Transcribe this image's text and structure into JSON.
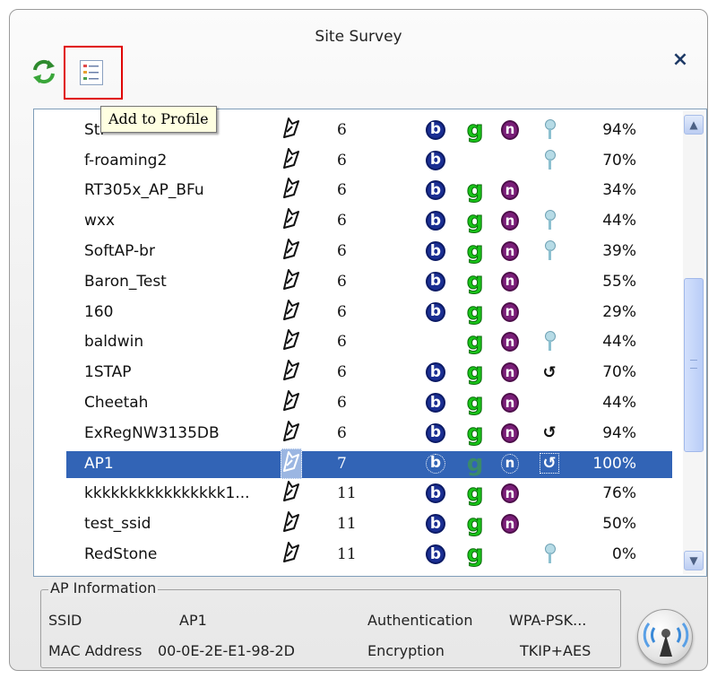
{
  "window": {
    "title": "Site Survey",
    "close_label": "×"
  },
  "toolbar": {
    "tooltip": "Add to Profile"
  },
  "list": {
    "rows": [
      {
        "ssid": "Sti",
        "channel": "6",
        "b": true,
        "g": true,
        "n": true,
        "security": "key",
        "signal": "94%"
      },
      {
        "ssid": "f-roaming2",
        "channel": "6",
        "b": true,
        "g": false,
        "n": false,
        "security": "key",
        "signal": "70%"
      },
      {
        "ssid": "RT305x_AP_BFu",
        "channel": "6",
        "b": true,
        "g": true,
        "n": true,
        "security": "",
        "signal": "34%"
      },
      {
        "ssid": "wxx",
        "channel": "6",
        "b": true,
        "g": true,
        "n": true,
        "security": "key",
        "signal": "44%"
      },
      {
        "ssid": "SoftAP-br",
        "channel": "6",
        "b": true,
        "g": true,
        "n": true,
        "security": "key",
        "signal": "39%"
      },
      {
        "ssid": "Baron_Test",
        "channel": "6",
        "b": true,
        "g": true,
        "n": true,
        "security": "",
        "signal": "55%"
      },
      {
        "ssid": "160",
        "channel": "6",
        "b": true,
        "g": true,
        "n": true,
        "security": "",
        "signal": "29%"
      },
      {
        "ssid": "baldwin",
        "channel": "6",
        "b": false,
        "g": true,
        "n": true,
        "security": "key",
        "signal": "44%"
      },
      {
        "ssid": "1STAP",
        "channel": "6",
        "b": true,
        "g": true,
        "n": true,
        "security": "wps",
        "signal": "70%"
      },
      {
        "ssid": "Cheetah",
        "channel": "6",
        "b": true,
        "g": true,
        "n": true,
        "security": "",
        "signal": "44%"
      },
      {
        "ssid": "ExRegNW3135DB",
        "channel": "6",
        "b": true,
        "g": true,
        "n": true,
        "security": "wps",
        "signal": "94%"
      },
      {
        "ssid": "AP1",
        "channel": "7",
        "b": true,
        "g": true,
        "n": true,
        "security": "wps",
        "signal": "100%",
        "selected": true
      },
      {
        "ssid": "kkkkkkkkkkkkkkkk1...",
        "channel": "11",
        "b": true,
        "g": true,
        "n": true,
        "security": "",
        "signal": "76%"
      },
      {
        "ssid": "test_ssid",
        "channel": "11",
        "b": true,
        "g": true,
        "n": true,
        "security": "",
        "signal": "50%"
      },
      {
        "ssid": "RedStone",
        "channel": "11",
        "b": true,
        "g": true,
        "n": false,
        "security": "key",
        "signal": "0%"
      }
    ]
  },
  "icons": {
    "b": "b",
    "g": "g",
    "n": "n",
    "wps": "↺"
  },
  "ap_info": {
    "legend": "AP Information",
    "ssid_label": "SSID",
    "ssid_value": "AP1",
    "auth_label": "Authentication",
    "auth_value": "WPA-PSK...",
    "mac_label": "MAC Address",
    "mac_value": "00-0E-2E-E1-98-2D",
    "enc_label": "Encryption",
    "enc_value": "TKIP+AES"
  },
  "colors": {
    "selection": "#3264b6",
    "b_icon": "#1a2e92",
    "g_icon": "#19c419",
    "n_icon": "#7a1e78",
    "highlight_border": "#e00000"
  }
}
